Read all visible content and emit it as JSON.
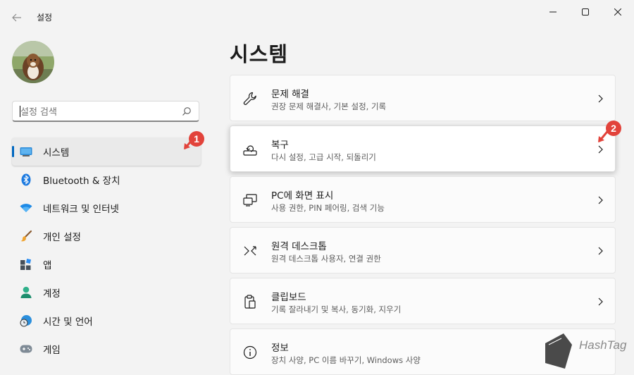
{
  "window": {
    "title": "설정"
  },
  "search": {
    "placeholder": "설정 검색"
  },
  "sidebar": {
    "items": [
      {
        "label": "시스템",
        "icon": "monitor-icon",
        "selected": true
      },
      {
        "label": "Bluetooth & 장치",
        "icon": "bluetooth-icon"
      },
      {
        "label": "네트워크 및 인터넷",
        "icon": "wifi-icon"
      },
      {
        "label": "개인 설정",
        "icon": "paintbrush-icon"
      },
      {
        "label": "앱",
        "icon": "apps-icon"
      },
      {
        "label": "계정",
        "icon": "person-icon"
      },
      {
        "label": "시간 및 언어",
        "icon": "globe-clock-icon"
      },
      {
        "label": "게임",
        "icon": "gamepad-icon"
      }
    ]
  },
  "main": {
    "title": "시스템",
    "cards": [
      {
        "title": "문제 해결",
        "subtitle": "권장 문제 해결사, 기본 설정, 기록",
        "icon": "wrench-icon"
      },
      {
        "title": "복구",
        "subtitle": "다시 설정, 고급 시작, 되돌리기",
        "icon": "recovery-icon"
      },
      {
        "title": "PC에 화면 표시",
        "subtitle": "사용 권한, PIN 페어링, 검색 기능",
        "icon": "project-screen-icon"
      },
      {
        "title": "원격 데스크톱",
        "subtitle": "원격 데스크톱 사용자, 연결 권한",
        "icon": "remote-desktop-icon"
      },
      {
        "title": "클립보드",
        "subtitle": "기록 잘라내기 및 복사, 동기화, 지우기",
        "icon": "clipboard-icon"
      },
      {
        "title": "정보",
        "subtitle": "장치 사양, PC 이름 바꾸기, Windows 사양",
        "icon": "info-icon"
      }
    ]
  },
  "annotations": {
    "badge1": "1",
    "badge2": "2"
  },
  "watermark": {
    "text": "HashTag"
  },
  "colors": {
    "accent": "#0067c0",
    "annotation": "#e2433b",
    "background": "#f3f3f3"
  }
}
